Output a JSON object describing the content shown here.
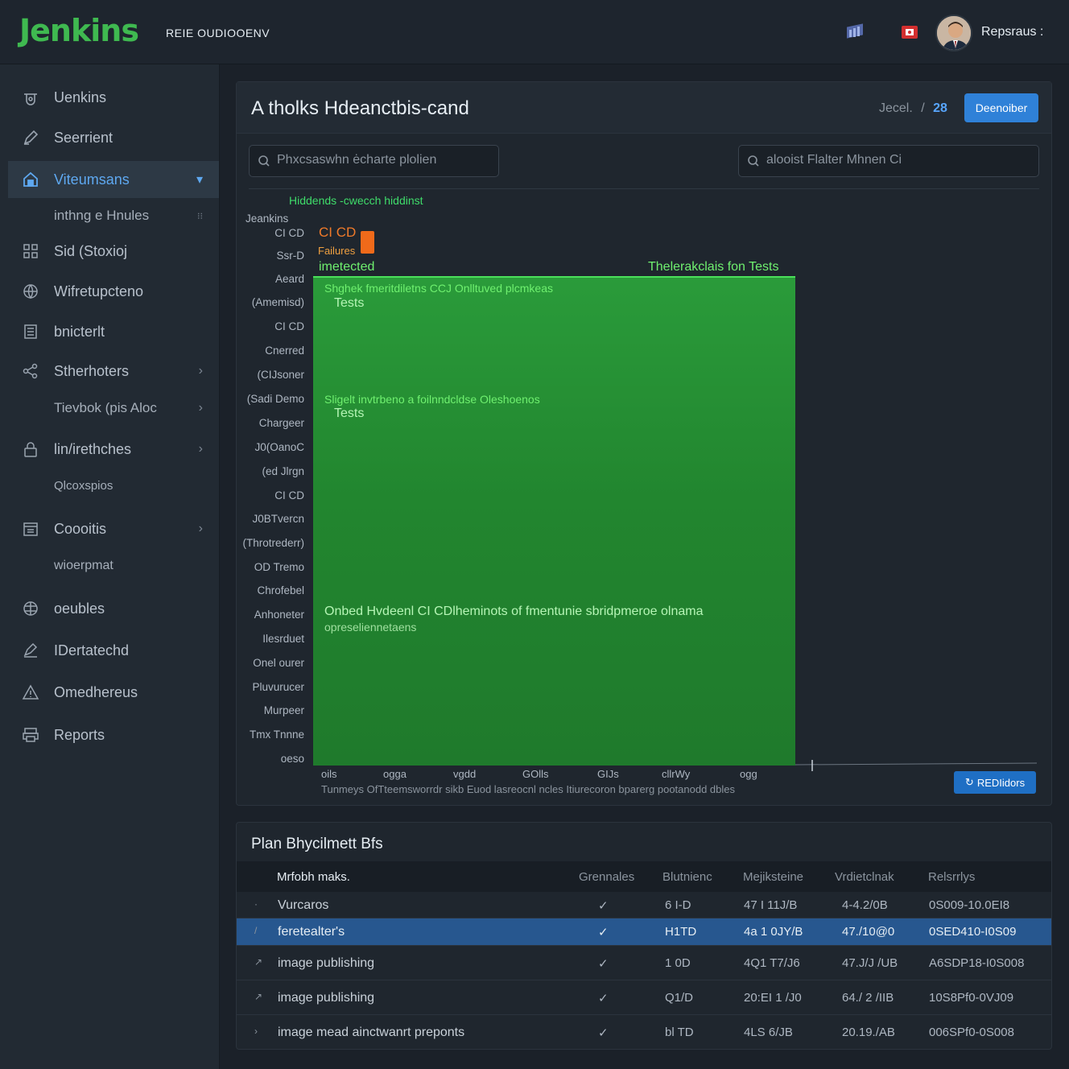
{
  "header": {
    "logo": "Jenkins",
    "subtitle": "REIE OUDIOOENV",
    "user_name": "Repsraus :"
  },
  "sidebar": {
    "items": [
      {
        "label": "Uenkins",
        "icon": "jenkins-icon"
      },
      {
        "label": "Seerrient",
        "icon": "pencil-icon"
      },
      {
        "label": "Viteumsans",
        "icon": "home-icon"
      },
      {
        "label": "inthng e Hnules",
        "icon": ""
      },
      {
        "label": "Sid (Stoxioj",
        "icon": "grid-icon"
      },
      {
        "label": "Wifretupcteno",
        "icon": "globe-icon"
      },
      {
        "label": "bnicterlt",
        "icon": "list-icon"
      },
      {
        "label": "Stherhoters",
        "icon": "share-icon"
      },
      {
        "label": "Tievbok (pis Aloc",
        "icon": ""
      },
      {
        "label": "lin/irethches",
        "icon": "lock-icon"
      },
      {
        "label": "Qlcoxspios",
        "icon": ""
      },
      {
        "label": "Coooitis",
        "icon": "calendar-icon"
      },
      {
        "label": "wioerpmat",
        "icon": ""
      },
      {
        "label": "oeubles",
        "icon": "globe-icon"
      },
      {
        "label": "IDertatechd",
        "icon": "edit-icon"
      },
      {
        "label": "Omedhereus",
        "icon": "warning-icon"
      },
      {
        "label": "Reports",
        "icon": "printer-icon"
      }
    ]
  },
  "main": {
    "title": "A tholks Hdeanctbis-cand",
    "breadcrumb": "Jecel.",
    "breadcrumb_sep": "/",
    "breadcrumb_num": "28",
    "primary_button": "Deenoiber",
    "search_left_placeholder": "Phxcsaswhn ėcharte plolien",
    "search_right_placeholder": "alooist Flalter Mhnen Ci",
    "chart_button": "REDIidors"
  },
  "chart_data": {
    "type": "bar",
    "title": "Hiddends -cwecch hiddinst",
    "y_labels": [
      "Jeankins",
      "CI CD",
      "Ssr-D",
      "Aeard",
      "(Amemisd)",
      "CI CD",
      "Cnerred",
      "(CIJsoner",
      "(Sadi Demo",
      "Chargeer",
      "J0(OanoC",
      "(ed Jlrgn",
      "CI CD",
      "J0BTvercn",
      "(Throtrederr)",
      "OD Tremo",
      "Chrofebel",
      "Anhoneter",
      "Ilesrduet",
      "Onel ourer",
      "Pluvurucer",
      "Murpeer",
      "Tmx Tnnne",
      "oeso"
    ],
    "x_tick_labels": [
      "oils",
      "ogga",
      "vgdd",
      "GOlls",
      "GIJs",
      "cllrWy",
      "ogg"
    ],
    "annotations": [
      "CI CD",
      "Failures",
      "imetected",
      "Thelerakclais fon Tests",
      "Shghek fmeritdiletns CCJ Onlltuved plcmkeas",
      "Tests",
      "Sligelt invtrbeno a foilnndcldse Oleshoenos",
      "Tests",
      "Onbed Hvdeenl CI CDlheminots of fmentunie sbridpmeroe olnama",
      "opreseliennetaens"
    ],
    "caption": "Tunmeys OfTteemsworrdr sikb Euod lasreocnl ncles Itiurecoron bparerg pootanodd dbles"
  },
  "table": {
    "title": "Plan Bhycilmett Bfs",
    "columns": [
      "Mrfobh maks.",
      "Grennales",
      "Blutnienc",
      "Mejiksteine",
      "Vrdietclnak",
      "Relsrrlys"
    ],
    "rows": [
      {
        "name": "Vurcaros",
        "check": "✓",
        "c2": "6 I-D",
        "c3": "47 I 11J/B",
        "c4": "4-4.2/0B",
        "c5": "0S009-10.0EI8"
      },
      {
        "name": "feretealter's",
        "check": "✓",
        "c2": "H1TD",
        "c3": "4a 1 0JY/B",
        "c4": "47./10@0",
        "c5": "0SED410-I0S09"
      },
      {
        "name": "image publishing",
        "check": "✓",
        "c2": "1 0D",
        "c3": "4Q1 T7/J6",
        "c4": "47.J/J /UB",
        "c5": "A6SDP18-I0S008"
      },
      {
        "name": "image publishing",
        "check": "✓",
        "c2": "Q1/D",
        "c3": "20:EI 1 /J0",
        "c4": "64./ 2 /IIB",
        "c5": "10S8Pf0-0VJ09"
      },
      {
        "name": "image mead ainctwanrt preponts",
        "check": "✓",
        "c2": "bl TD",
        "c3": "4LS 6/JB",
        "c4": "20.19./AB",
        "c5": "006SPf0-0S008"
      }
    ]
  }
}
